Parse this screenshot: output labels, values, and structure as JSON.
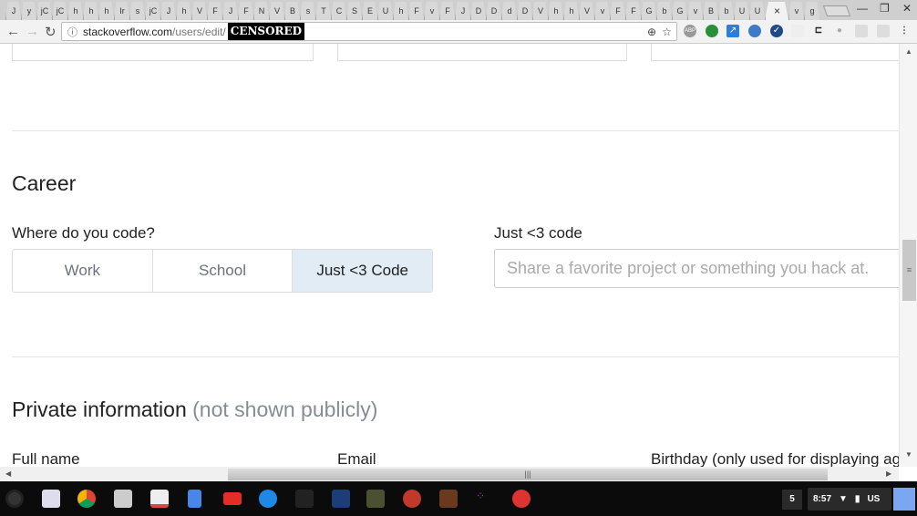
{
  "browser": {
    "tabs": [
      "J",
      "y",
      "jC",
      "jC",
      "h",
      "h",
      "h",
      "Ir",
      "s",
      "jC",
      "J",
      "h",
      "V",
      "F",
      "J",
      "F",
      "N",
      "V",
      "B",
      "s",
      "T",
      "C",
      "S",
      "E",
      "U",
      "h",
      "F",
      "v",
      "F",
      "J",
      "D",
      "D",
      "d",
      "D",
      "V",
      "h",
      "h",
      "V",
      "v",
      "F",
      "F",
      "G",
      "b",
      "G",
      "v",
      "B",
      "b",
      "U",
      "U"
    ],
    "active_tab_close": "×",
    "after_tabs": [
      "v",
      "g"
    ],
    "url_host": "stackoverflow.com",
    "url_path": "/users/edit/",
    "url_censored": "CENSORED",
    "extensions": [
      "adblock-icon",
      "green-circle-icon",
      "resize-icon",
      "globe-icon",
      "check-badge-icon",
      "blank-ext-icon",
      "bracket-icon",
      "speech-icon",
      "puzzle-icon",
      "puzzle-icon"
    ]
  },
  "career": {
    "heading": "Career",
    "where_label": "Where do you code?",
    "options": [
      "Work",
      "School",
      "Just <3 Code"
    ],
    "selected": "Just <3 Code",
    "project_label": "Just <3 code",
    "project_placeholder": "Share a favorite project or something you hack at."
  },
  "private": {
    "heading": "Private information",
    "note": "(not shown publicly)",
    "fields": [
      "Full name",
      "Email",
      "Birthday (only used for displaying age"
    ]
  },
  "shelf": {
    "notifications": "5",
    "time": "8:57",
    "ime": "US"
  },
  "colors": {
    "selected_option": "#e1ecf4",
    "shelf": "#0b0b0b"
  }
}
